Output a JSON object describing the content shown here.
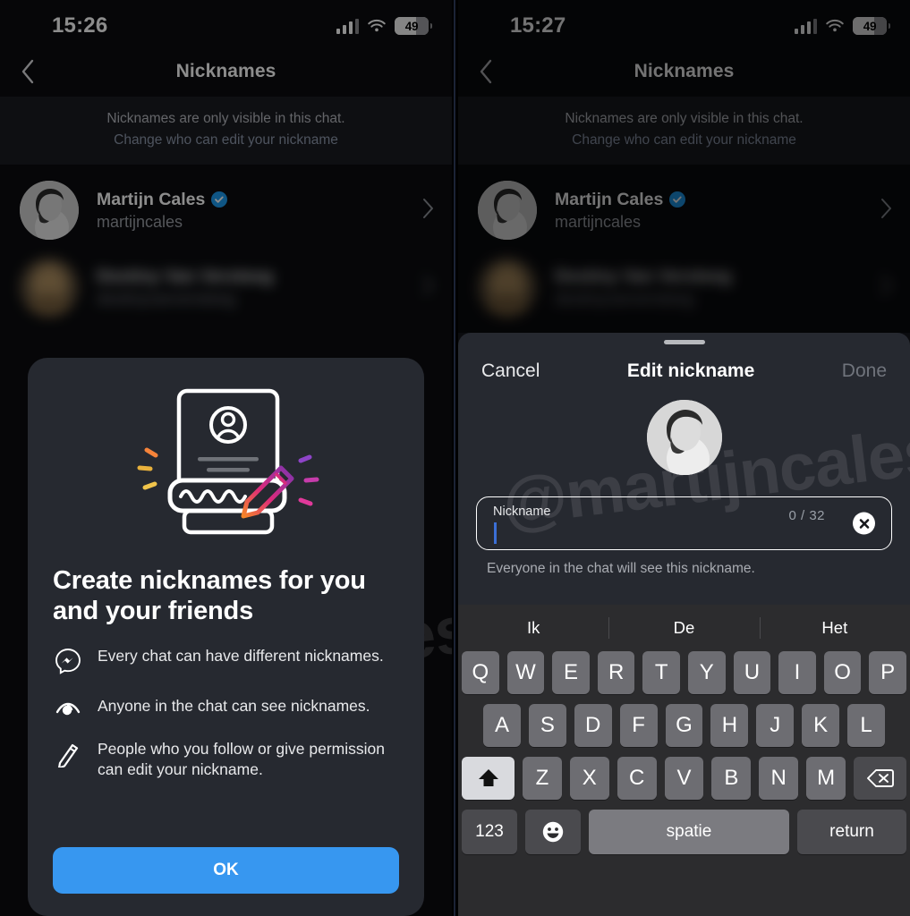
{
  "left": {
    "status": {
      "time": "15:26",
      "battery": "49",
      "signal_icon": "cellular-signal-icon",
      "wifi_icon": "wifi-icon",
      "battery_icon": "battery-icon"
    },
    "nav": {
      "back_icon": "chevron-left-icon",
      "title": "Nicknames"
    },
    "subheader": {
      "line1": "Nicknames are only visible in this chat.",
      "line2": "Change who can edit your nickname"
    },
    "contacts": [
      {
        "name": "Martijn Cales",
        "handle": "martijncales",
        "verified": true,
        "blurred": false,
        "chevron": "›"
      },
      {
        "name": "Destiny Van Versteeg",
        "handle": "destinyvanversteeg",
        "verified": false,
        "blurred": true,
        "chevron": "›"
      }
    ],
    "modal": {
      "illustration_icon": "nickname-card-pencil-illustration",
      "title": "Create nicknames for you and your friends",
      "bullets": [
        {
          "icon": "messenger-icon",
          "text": "Every chat can have different nicknames."
        },
        {
          "icon": "visibility-eye-icon",
          "text": "Anyone in the chat can see nicknames."
        },
        {
          "icon": "pencil-icon",
          "text": "People who you follow or give permission can edit your nickname."
        }
      ],
      "ok_label": "OK"
    },
    "watermark": "@martijncales"
  },
  "right": {
    "status": {
      "time": "15:27",
      "battery": "49",
      "signal_icon": "cellular-signal-icon",
      "wifi_icon": "wifi-icon",
      "battery_icon": "battery-icon"
    },
    "nav": {
      "back_icon": "chevron-left-icon",
      "title": "Nicknames"
    },
    "subheader": {
      "line1": "Nicknames are only visible in this chat.",
      "line2": "Change who can edit your nickname"
    },
    "contacts": [
      {
        "name": "Martijn Cales",
        "handle": "martijncales",
        "verified": true,
        "blurred": false,
        "chevron": "›"
      },
      {
        "name": "Destiny Van Versteeg",
        "handle": "destinyvanversteeg",
        "verified": false,
        "blurred": true,
        "chevron": "›"
      }
    ],
    "sheet": {
      "cancel_label": "Cancel",
      "title": "Edit nickname",
      "done_label": "Done",
      "avatar_icon": "profile-avatar",
      "field": {
        "label": "Nickname",
        "value": "",
        "placeholder": "Nickname",
        "counter": "0 / 32",
        "clear_icon": "clear-x-icon"
      },
      "hint": "Everyone in the chat will see this nickname."
    },
    "keyboard": {
      "suggestions": [
        "Ik",
        "De",
        "Het"
      ],
      "row1": [
        "Q",
        "W",
        "E",
        "R",
        "T",
        "Y",
        "U",
        "I",
        "O",
        "P"
      ],
      "row2": [
        "A",
        "S",
        "D",
        "F",
        "G",
        "H",
        "J",
        "K",
        "L"
      ],
      "row3": [
        "Z",
        "X",
        "C",
        "V",
        "B",
        "N",
        "M"
      ],
      "shift_icon": "shift-up-arrow-icon",
      "delete_icon": "backspace-delete-icon",
      "numbers_label": "123",
      "emoji_icon": "emoji-smiley-icon",
      "space_label": "spatie",
      "return_label": "return"
    },
    "watermark": "@martijncales"
  },
  "colors": {
    "accent_blue": "#3797f0",
    "verified_blue": "#1d9bf0",
    "sheet_bg": "#262930",
    "panel_bg": "#0b0c0f",
    "key_bg": "#6d6d72",
    "shift_active": "#d9dade"
  }
}
